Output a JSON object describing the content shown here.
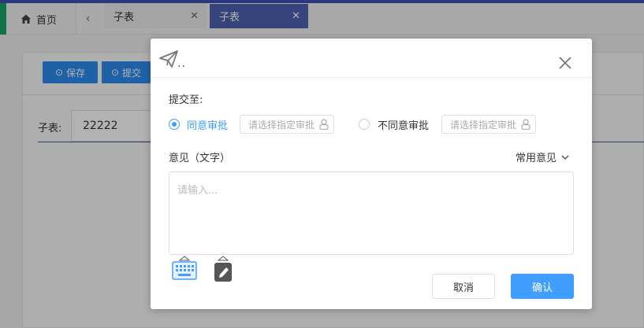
{
  "tabs": {
    "home_label": "首页",
    "prev_icon": "chevron-left-icon",
    "items": [
      {
        "label": "子表",
        "close": "✕"
      },
      {
        "label": "子表",
        "close": "✕"
      }
    ]
  },
  "toolbar": {
    "save_label": "保存",
    "submit_label": "提交"
  },
  "form": {
    "field_label": "子表:",
    "field_value": "22222"
  },
  "modal": {
    "title_suffix": "..",
    "submit_to_label": "提交至:",
    "agree_label": "同意审批",
    "disagree_label": "不同意审批",
    "approver_placeholder_1": "请选择指定审批",
    "approver_placeholder_2": "请选择指定审批",
    "opinion_label": "意见（文字）",
    "common_opinion_label": "常用意见",
    "opinion_placeholder": "请输入...",
    "cancel_label": "取消",
    "confirm_label": "确认"
  },
  "colors": {
    "accent": "#409eff",
    "active_tab": "#5062b0",
    "top_strip": "#3f51b5",
    "button_blue": "#2d8cf0"
  }
}
